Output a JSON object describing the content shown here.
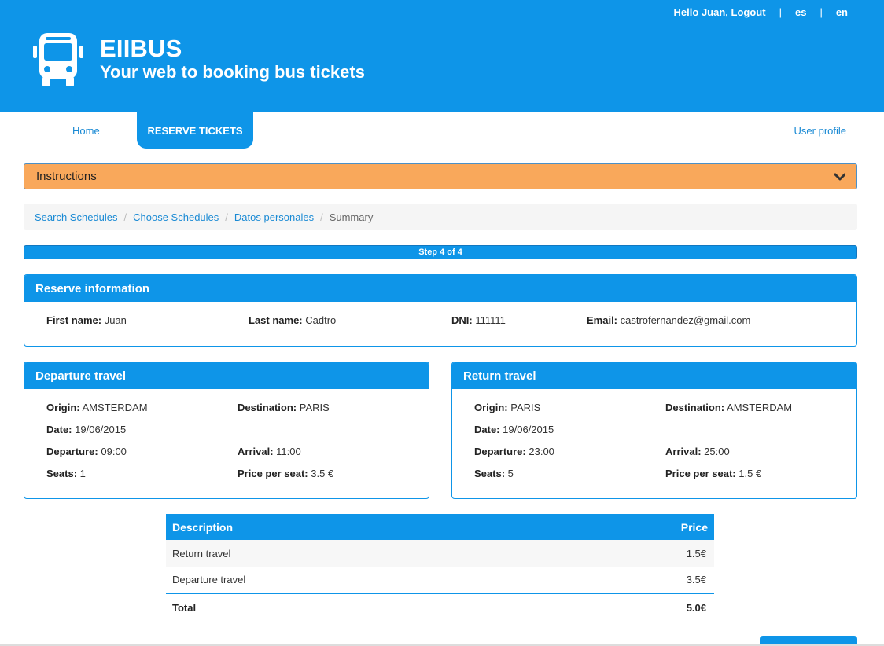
{
  "header": {
    "greeting": "Hello Juan,",
    "logout": "Logout",
    "sep1": "|",
    "sep2": "|",
    "lang_es": "es",
    "lang_en": "en",
    "title": "EIIBUS",
    "subtitle": "Your web to booking bus tickets",
    "icon": "bus-icon"
  },
  "nav": {
    "home": "Home",
    "reserve": "RESERVE TICKETS",
    "profile": "User profile"
  },
  "instructions": {
    "label": "Instructions",
    "icon": "chevron-down-icon"
  },
  "breadcrumb": {
    "items": [
      "Search Schedules",
      "Choose Schedules",
      "Datos personales",
      "Summary"
    ],
    "separator": "/"
  },
  "progress": {
    "label": "Step 4 of 4",
    "value": 1.0
  },
  "reserve_info": {
    "title": "Reserve information",
    "first_name_label": "First name:",
    "first_name": "Juan",
    "last_name_label": "Last name:",
    "last_name": "Cadtro",
    "dni_label": "DNI:",
    "dni": "111111",
    "email_label": "Email:",
    "email": "castrofernandez@gmail.com"
  },
  "departure": {
    "title": "Departure travel",
    "origin_label": "Origin:",
    "origin": "AMSTERDAM",
    "destination_label": "Destination:",
    "destination": "PARIS",
    "date_label": "Date:",
    "date": "19/06/2015",
    "departure_label": "Departure:",
    "departure": "09:00",
    "arrival_label": "Arrival:",
    "arrival": "11:00",
    "seats_label": "Seats:",
    "seats": "1",
    "price_label": "Price per seat:",
    "price": "3.5 €"
  },
  "return": {
    "title": "Return travel",
    "origin_label": "Origin:",
    "origin": "PARIS",
    "destination_label": "Destination:",
    "destination": "AMSTERDAM",
    "date_label": "Date:",
    "date": "19/06/2015",
    "departure_label": "Departure:",
    "departure": "23:00",
    "arrival_label": "Arrival:",
    "arrival": "25:00",
    "seats_label": "Seats:",
    "seats": "5",
    "price_label": "Price per seat:",
    "price": "1.5 €"
  },
  "summary": {
    "col_description": "Description",
    "col_price": "Price",
    "rows": [
      {
        "description": "Return travel",
        "price": "1.5€"
      },
      {
        "description": "Departure travel",
        "price": "3.5€"
      }
    ],
    "total_label": "Total",
    "total": "5.0€"
  },
  "colors": {
    "primary": "#0e95e8",
    "instructions_bg": "#f9a85b",
    "link": "#1a8ad4"
  }
}
